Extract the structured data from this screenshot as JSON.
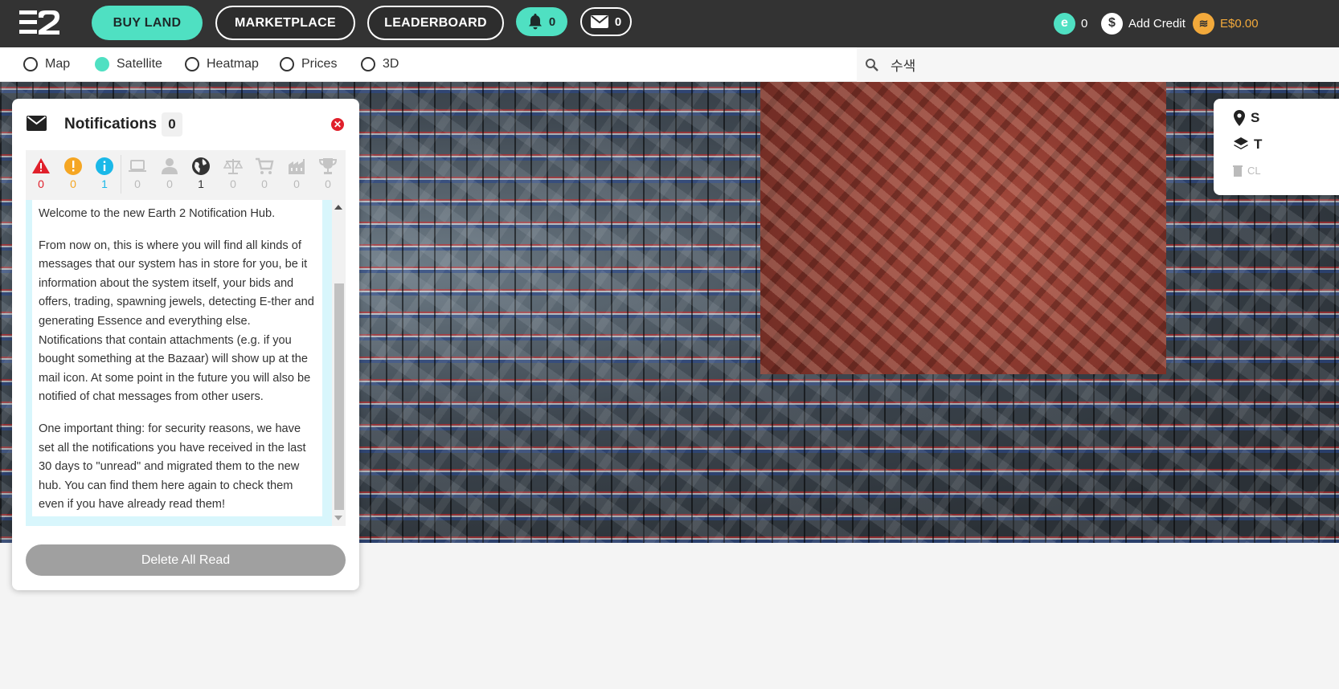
{
  "topbar": {
    "nav": {
      "buy_land": "BUY LAND",
      "marketplace": "MARKETPLACE",
      "leaderboard": "LEADERBOARD"
    },
    "bell_count": "0",
    "mail_count": "0",
    "essence_count": "0",
    "add_credit": "Add Credit",
    "balance": "E$0.00"
  },
  "layers": {
    "options": [
      "Map",
      "Satellite",
      "Heatmap",
      "Prices",
      "3D"
    ],
    "selected": "Satellite"
  },
  "search": {
    "value": "수색"
  },
  "map_info": {
    "row1": "S",
    "row2": "T",
    "row3": "CL"
  },
  "notifications": {
    "title": "Notifications",
    "count": "0",
    "filters": [
      "0",
      "0",
      "1",
      "0",
      "0",
      "1",
      "0",
      "0",
      "0",
      "0"
    ],
    "message": {
      "p1": "Welcome to the new Earth 2 Notification Hub.",
      "p2": "From now on, this is where you will find all kinds of messages that our system has in store for you, be it information about the system itself, your bids and offers, trading, spawning jewels, detecting E-ther and generating Essence and everything else. Notifications that contain attachments (e.g. if you bought something at the Bazaar) will show up at the mail icon. At some point in the future you will also be notified of chat messages from other users.",
      "p3": "One important thing: for security reasons, we have set all the notifications you have received in the last 30 days to \"unread\" and migrated them to the new hub. You can find them here again to check them even if you have already read them!"
    },
    "delete_all_read": "Delete All Read"
  },
  "colors": {
    "accent": "#4fe0c2",
    "topbar": "#333333",
    "error": "#e0202b",
    "warning": "#f5a623",
    "info": "#1ab8e8"
  }
}
